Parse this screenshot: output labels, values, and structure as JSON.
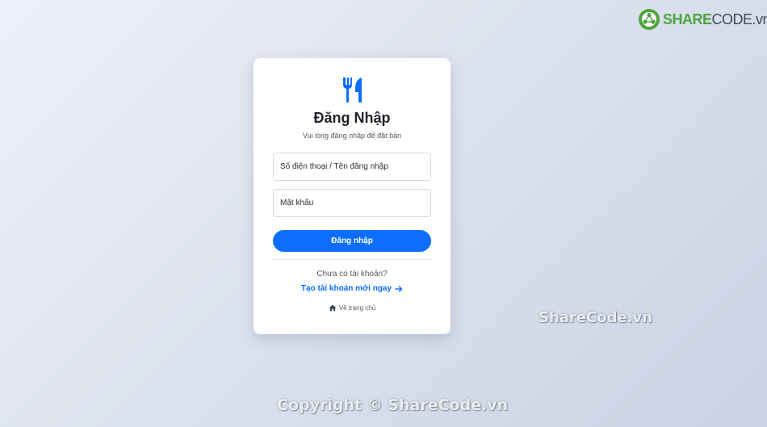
{
  "brand": {
    "share": "SHARE",
    "code": "CODE.vn"
  },
  "watermarks": {
    "middle": "ShareCode.vn",
    "bottom": "Copyright © ShareCode.vn"
  },
  "login": {
    "icon": "utensils-icon",
    "title": "Đăng Nhập",
    "subtitle": "Vui lòng đăng nhập để đặt bàn",
    "phone_placeholder": "Số điện thoại / Tên đăng nhập",
    "password_placeholder": "Mật khẩu",
    "submit_label": "Đăng nhập",
    "no_account_text": "Chưa có tài khoản?",
    "register_label": "Tạo tài khoản mới ngay",
    "home_label": "Về trang chủ"
  },
  "colors": {
    "primary": "#0d6efd",
    "brand_green": "#4fa33f",
    "card_background": "#ffffff"
  }
}
